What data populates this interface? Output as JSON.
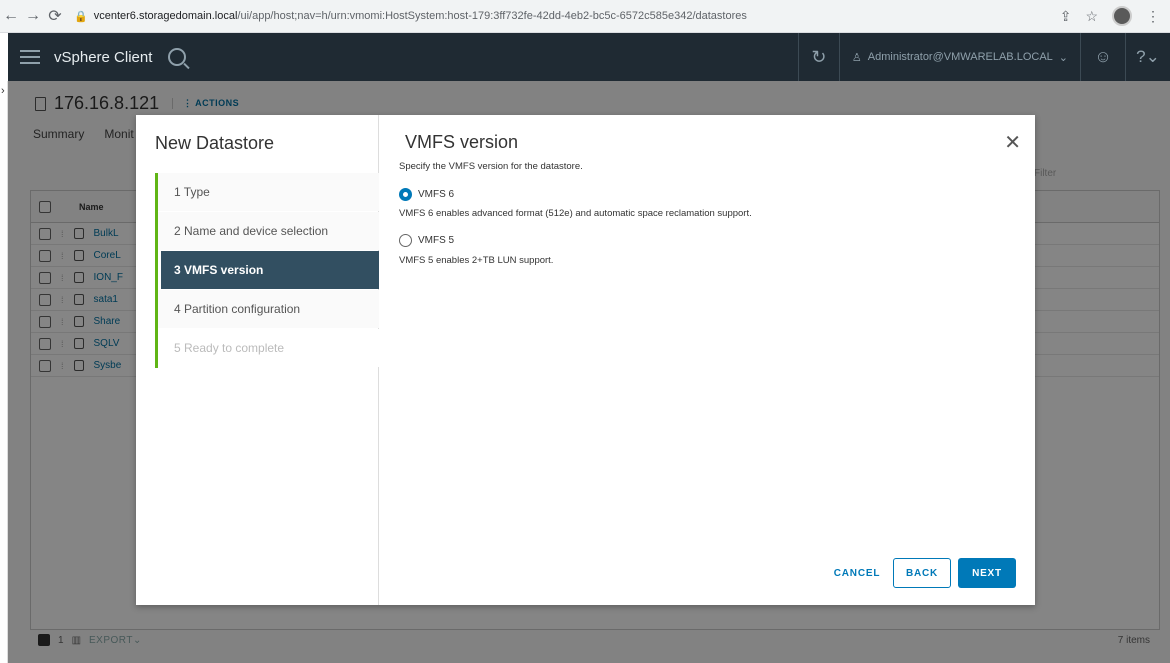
{
  "browser": {
    "url_host": "vcenter6.storagedomain.local",
    "url_path": "/ui/app/host;nav=h/urn:vmomi:HostSystem:host-179:3ff732fe-42dd-4eb2-bc5c-6572c585e342/datastores"
  },
  "header": {
    "app_title": "vSphere Client",
    "user": "Administrator@VMWARELAB.LOCAL"
  },
  "page": {
    "host": "176.16.8.121",
    "actions_label": "ACTIONS",
    "tabs": [
      "Summary",
      "Monit"
    ],
    "filter_placeholder": "Filter",
    "grid_header_name": "Name",
    "rows": [
      "BulkL",
      "CoreL",
      "ION_F",
      "sata1",
      "Share",
      "SQLV",
      "Sysbe"
    ],
    "footer_selected": "1",
    "export_label": "EXPORT",
    "item_count": "7 items"
  },
  "wizard": {
    "title": "New Datastore",
    "steps": [
      {
        "label": "1  Type",
        "state": "done"
      },
      {
        "label": "2  Name and device selection",
        "state": "done"
      },
      {
        "label": "3  VMFS version",
        "state": "active"
      },
      {
        "label": "4  Partition configuration",
        "state": "pending"
      },
      {
        "label": "5  Ready to complete",
        "state": "disabled"
      }
    ],
    "content_title": "VMFS version",
    "description": "Specify the VMFS version for the datastore.",
    "options": [
      {
        "label": "VMFS 6",
        "help": "VMFS 6 enables advanced format (512e) and automatic space reclamation support.",
        "selected": true
      },
      {
        "label": "VMFS 5",
        "help": "VMFS 5 enables 2+TB LUN support.",
        "selected": false
      }
    ],
    "buttons": {
      "cancel": "CANCEL",
      "back": "BACK",
      "next": "NEXT"
    }
  }
}
